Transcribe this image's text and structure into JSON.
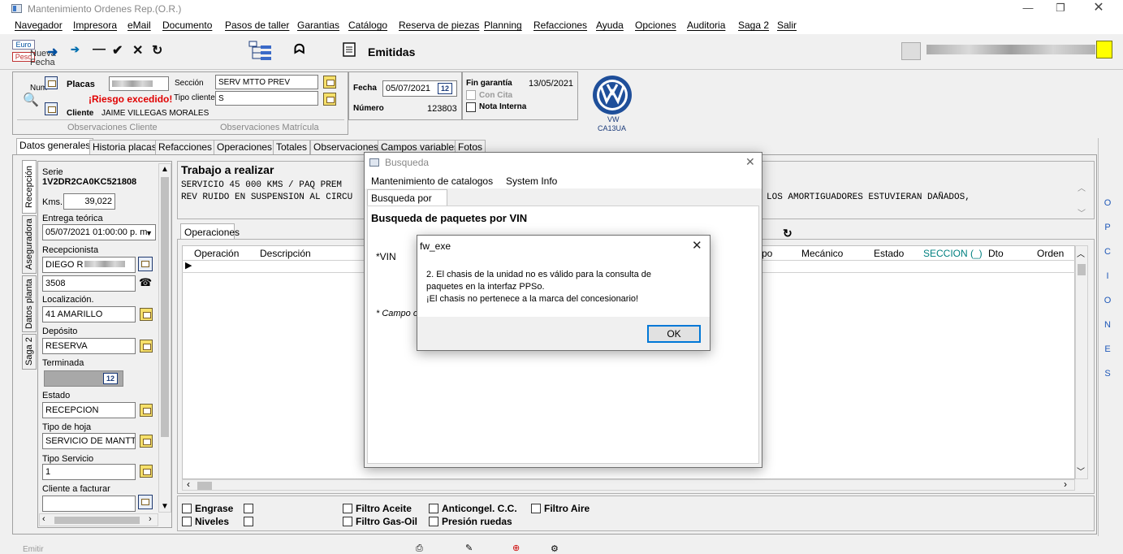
{
  "window": {
    "title": "Mantenimiento Ordenes Rep.(O.R.)"
  },
  "menu": [
    "Navegador",
    "Impresora",
    "eMail",
    "Documento",
    "Pasos de taller",
    "Garantias",
    "Catálogo",
    "Reserva de piezas",
    "Planning",
    "Refacciones",
    "Ayuda",
    "Opciones",
    "Auditoria",
    "Saga 2",
    "Salir"
  ],
  "toolbar": {
    "euro": "Euro",
    "peso": "Peso",
    "nueva": "Nueva",
    "fecha": "Fecha",
    "emitidas": "Emitidas"
  },
  "header": {
    "num_label": "Num",
    "placas_label": "Placas",
    "riesgo": "¡Riesgo excedido!",
    "cliente_label": "Cliente",
    "cliente_value": "JAIME VILLEGAS MORALES",
    "seccion_label": "Sección",
    "seccion_value": "SERV MTTO PREV",
    "tipo_cliente_label": "Tipo cliente",
    "tipo_cliente_value": "S",
    "obs_cliente": "Observaciones  Cliente",
    "obs_matricula": "Observaciones  Matrícula",
    "fecha_label": "Fecha",
    "fecha_value": "05/07/2021",
    "numero_label": "Número",
    "numero_value": "123803",
    "fin_garantia_label": "Fin garantía",
    "fin_garantia_value": "13/05/2021",
    "con_cita": "Con Cita",
    "nota_interna": "Nota Interna",
    "brand": "VW",
    "brand_code": "CA13UA"
  },
  "tabs": [
    "Datos generales",
    "Historia placas",
    "Refacciones",
    "Operaciones",
    "Totales",
    "Observaciones",
    "Campos variables",
    "Fotos"
  ],
  "vtabs": [
    "Recepción",
    "Aseguradora",
    "Datos planta",
    "Saga 2"
  ],
  "left": {
    "serie_label": "Serie",
    "serie_value": "1V2DR2CA0KC521808",
    "kms_label": "Kms.",
    "kms_value": "39,022",
    "entrega_label": "Entrega teórica",
    "entrega_value": "05/07/2021 01:00:00 p. m.",
    "recepcionista_label": "Recepcionista",
    "recepcionista_value": "DIEGO R",
    "recepcionista_code": "3508",
    "localizacion_label": "Localización.",
    "localizacion_value": "41 AMARILLO",
    "deposito_label": "Depósito",
    "deposito_value": "RESERVA",
    "terminada_label": "Terminada",
    "estado_label": "Estado",
    "estado_value": "RECEPCION",
    "tipo_hoja_label": "Tipo de hoja",
    "tipo_hoja_value": "SERVICIO DE MANTT",
    "tipo_servicio_label": "Tipo Servicio",
    "tipo_servicio_value": "1",
    "cliente_facturar_label": "Cliente a facturar"
  },
  "work": {
    "title": "Trabajo a realizar",
    "line1a": "SERVICIO 45 000 KMS  /  PAQ PREM",
    "line2a": "REV RUIDO EN SUSPENSION AL CIRCU",
    "line2b": "LOS AMORTIGUADORES ESTUVIERAN DAÑADOS,"
  },
  "ops": {
    "tab": "Operaciones",
    "cols": [
      "Operación",
      "Descripción",
      "po",
      "Mecánico",
      "Estado",
      "SECCION (_)",
      "Dto",
      "Orden"
    ]
  },
  "checks": [
    "Engrase",
    "Niveles",
    "Filtro Aceite",
    "Filtro Gas-Oil",
    "Anticongel. C.C.",
    "Presión ruedas",
    "Filtro Aire"
  ],
  "opciones": [
    "O",
    "P",
    "C",
    "I",
    "O",
    "N",
    "E",
    "S"
  ],
  "bottom": {
    "emitir": "Emitir"
  },
  "busqueda": {
    "title": "Busqueda",
    "menu1": "Mantenimiento de catalogos",
    "menu2": "System Info",
    "tab": "Busqueda por VIN",
    "heading": "Busqueda de paquetes por VIN",
    "vin_label": "*VIN",
    "campo": "* Campo o"
  },
  "msgbox": {
    "title": "fw_exe",
    "line1": "2. El chasis de la unidad no es válido para la consulta de",
    "line2": "paquetes en la interfaz PPSo.",
    "line3": "¡El chasis no pertenece a la marca del concesionario!",
    "ok": "OK"
  },
  "colors": {
    "accent": "#1f58b8",
    "risk": "#e00000",
    "seccion": "#008080"
  }
}
